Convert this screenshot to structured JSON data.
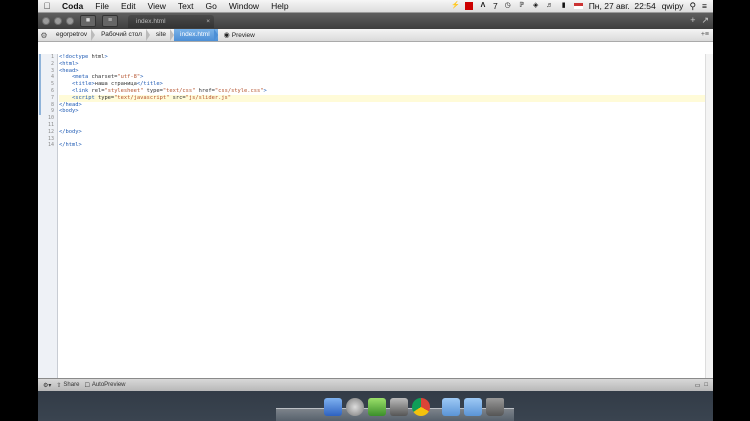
{
  "menubar": {
    "app_name": "Coda",
    "menus": [
      "File",
      "Edit",
      "View",
      "Text",
      "Go",
      "Window",
      "Help"
    ],
    "clock": "Пн, 27 авг.  22:54",
    "user": "qwipy",
    "tray_number": "7"
  },
  "window": {
    "doc_tab_title": "index.html"
  },
  "pathbar": {
    "crumbs": [
      "egorpetrov",
      "Рабочий стол",
      "site",
      "index.html"
    ],
    "preview_label": "Preview"
  },
  "editor": {
    "line_numbers": [
      "1",
      "2",
      "3",
      "4",
      "5",
      "6",
      "7",
      "8",
      "9",
      "10",
      "11",
      "12",
      "13",
      "14"
    ],
    "lines": [
      "<!doctype html>",
      "<html>",
      "<head>",
      "    <meta charset=\"utf-8\">",
      "    <title>наша страница</title>",
      "    <link rel=\"stylesheet\" type=\"text/css\" href=\"css/style.css\">",
      "    <script type=\"text/javascript\" src=\"js/slider.js\"",
      "</head>",
      "<body>",
      "",
      "",
      "</body>",
      "",
      "</html>"
    ],
    "highlighted_line": 7
  },
  "statusbar": {
    "share_label": "Share",
    "autopreview_label": "AutoPreview"
  },
  "colors": {
    "selection": "#4c8fd6",
    "highlight_line": "#fffbd8",
    "tag": "#1e5ab4",
    "string": "#b4522d"
  }
}
